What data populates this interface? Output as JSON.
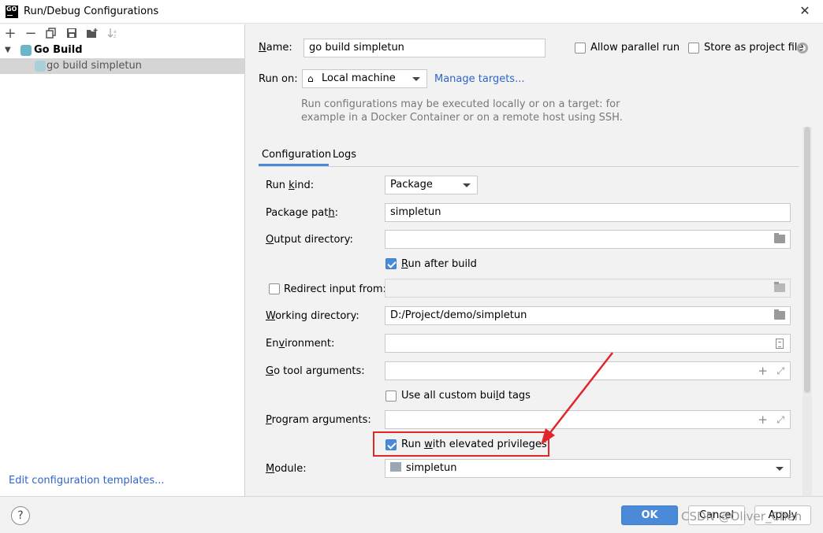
{
  "window": {
    "title": "Run/Debug Configurations",
    "app_icon_text": "GO"
  },
  "toolbar": {
    "buttons": [
      "add-icon",
      "remove-icon",
      "copy-icon",
      "save-icon",
      "new-folder-icon",
      "sort-icon"
    ]
  },
  "tree": {
    "group": "Go Build",
    "item": "go build simpletun"
  },
  "left_footer": {
    "edit_templates": "Edit configuration templates..."
  },
  "form": {
    "name_label": "Name:",
    "name_value": "go build simpletun",
    "allow_parallel": "Allow parallel run",
    "store_as_project": "Store as project file",
    "run_on_label": "Run on:",
    "run_on_value": "Local machine",
    "manage_targets": "Manage targets...",
    "hint": "Run configurations may be executed locally or on a target: for example in a Docker Container or on a remote host using SSH."
  },
  "tabs": [
    "Configuration",
    "Logs"
  ],
  "config": {
    "run_kind_label": "Run kind:",
    "run_kind_value": "Package",
    "package_path_label": "Package path:",
    "package_path_value": "simpletun",
    "output_dir_label": "Output directory:",
    "output_dir_value": "",
    "run_after_build": "Run after build",
    "redirect_input": "Redirect input from:",
    "working_dir_label": "Working directory:",
    "working_dir_value": "D:/Project/demo/simpletun",
    "environment_label": "Environment:",
    "go_tool_args_label": "Go tool arguments:",
    "use_custom_tags": "Use all custom build tags",
    "program_args_label": "Program arguments:",
    "elevated": "Run with elevated privileges",
    "module_label": "Module:",
    "module_value": "simpletun"
  },
  "buttons": {
    "ok": "OK",
    "cancel": "Cancel",
    "apply": "Apply"
  },
  "watermark": "CSDN @Oliver_Chen",
  "checkbox_states": {
    "allow_parallel": false,
    "store_as_project": false,
    "run_after_build": true,
    "redirect_input": false,
    "use_custom_tags": false,
    "elevated": true
  },
  "colors": {
    "accent": "#4a8ad8",
    "link": "#2f65ca",
    "annotation": "#e0262a"
  }
}
